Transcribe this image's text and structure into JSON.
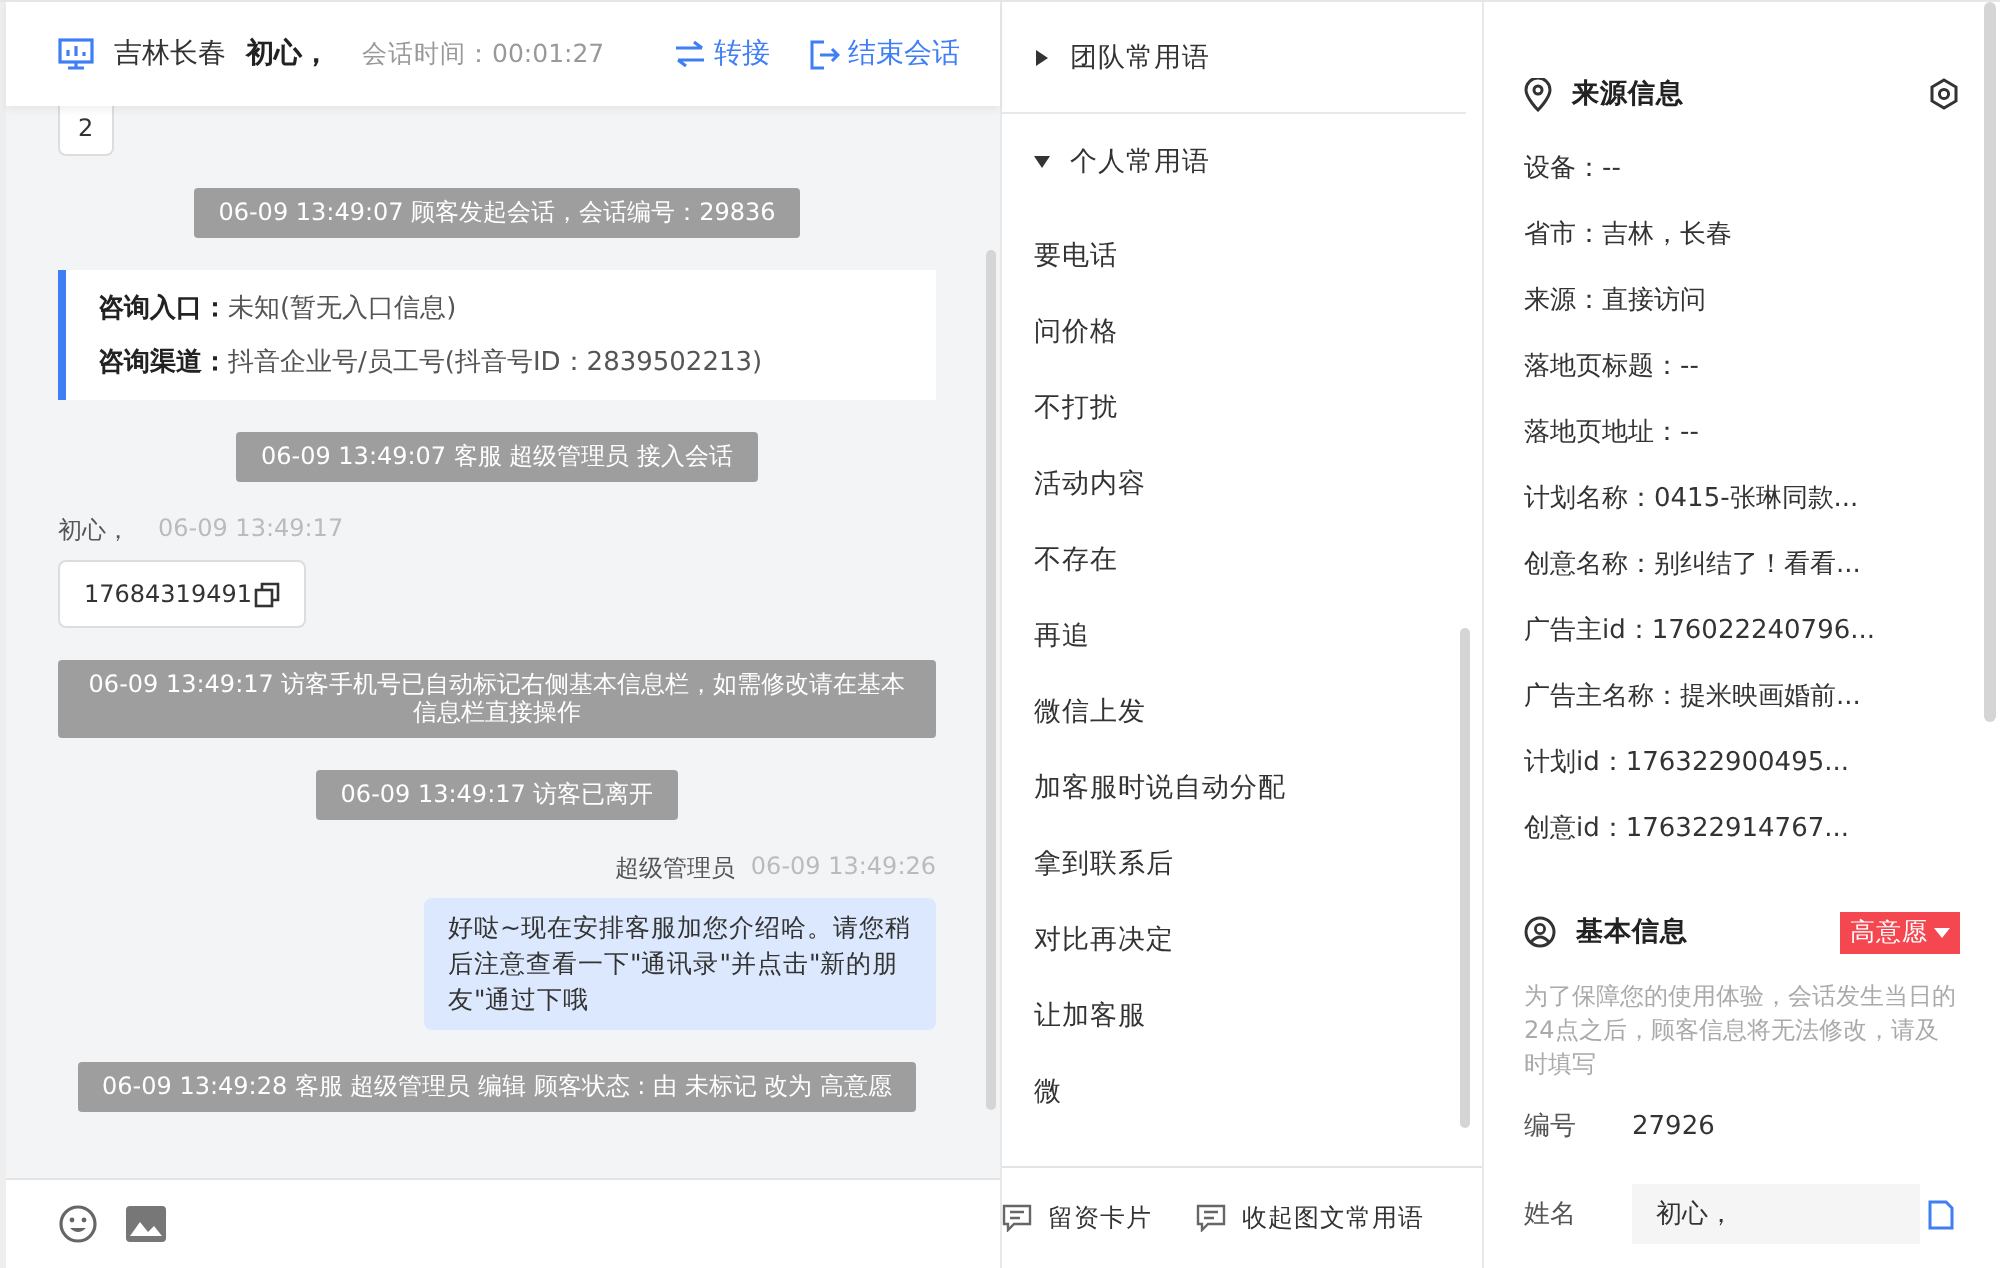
{
  "header": {
    "location": "吉林长春",
    "customer": "初心，",
    "duration_label": "会话时间：00:01:27",
    "actions": [
      {
        "kind": "transfer",
        "label": "转接"
      },
      {
        "kind": "end",
        "label": "结束会话"
      }
    ]
  },
  "messages": [
    {
      "kind": "number",
      "text": "2"
    },
    {
      "kind": "system",
      "text": "06-09 13:49:07 顾客发起会话，会话编号：29836"
    },
    {
      "kind": "info",
      "rows": [
        {
          "label": "咨询入口：",
          "value": "未知(暂无入口信息)"
        },
        {
          "label": "咨询渠道：",
          "value": "抖音企业号/员工号(抖音号ID：2839502213)"
        }
      ]
    },
    {
      "kind": "system",
      "text": "06-09 13:49:07 客服 超级管理员 接入会话"
    },
    {
      "kind": "visitor",
      "sender": "初心，",
      "time": "06-09 13:49:17",
      "text": "17684319491"
    },
    {
      "kind": "system",
      "text": "06-09 13:49:17 访客手机号已自动标记右侧基本信息栏，如需修改请在基本信息栏直接操作"
    },
    {
      "kind": "system",
      "text": "06-09 13:49:17 访客已离开"
    },
    {
      "kind": "agent",
      "sender": "超级管理员",
      "time": "06-09 13:49:26",
      "text": "好哒~现在安排客服加您介绍哈。请您稍后注意查看一下\"通讯录\"并点击\"新的朋友\"通过下哦"
    },
    {
      "kind": "system",
      "text": "06-09 13:49:28 客服 超级管理员 编辑 顾客状态 : 由 未标记 改为 高意愿"
    }
  ],
  "phrases": {
    "groups": [
      {
        "label": "团队常用语",
        "expanded": false
      },
      {
        "label": "个人常用语",
        "expanded": true
      }
    ],
    "items": [
      "要电话",
      "问价格",
      "不打扰",
      "活动内容",
      "不存在",
      "再追",
      "微信上发",
      "加客服时说自动分配",
      "拿到联系后",
      "对比再决定",
      "让加客服",
      "微"
    ],
    "footer": [
      "留资卡片",
      "收起图文常用语"
    ]
  },
  "source_info": {
    "title": "来源信息",
    "items": [
      "设备：--",
      "省市：吉林，长春",
      "来源：直接访问",
      "落地页标题：--",
      "落地页地址：--",
      "计划名称：0415-张琳同款...",
      "创意名称：别纠结了！看看...",
      "广告主id：176022240796...",
      "广告主名称：提米映画婚前...",
      "计划id：176322900495...",
      "创意id：176322914767..."
    ]
  },
  "basic_info": {
    "title": "基本信息",
    "status_tag": "高意愿",
    "note": "为了保障您的使用体验，会话发生当日的24点之后，顾客信息将无法修改，请及时填写",
    "fields": [
      {
        "kind": "text",
        "label": "编号",
        "value": "27926"
      },
      {
        "kind": "input",
        "label": "姓名",
        "value": "初心，"
      }
    ]
  }
}
